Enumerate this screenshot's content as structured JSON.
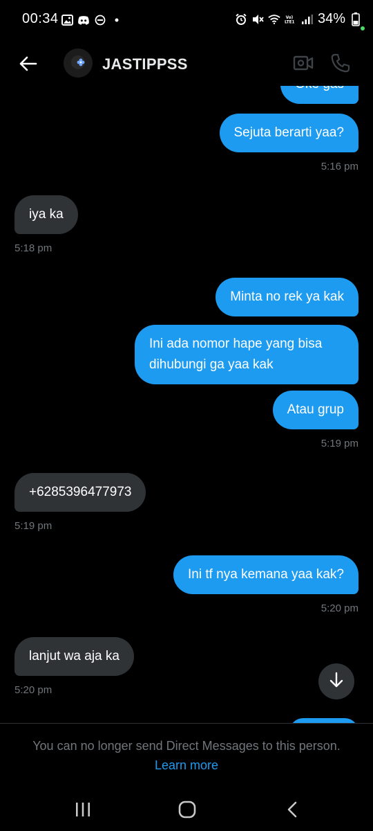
{
  "status_bar": {
    "time": "00:34",
    "battery": "34%",
    "left_icons": [
      "gallery-icon",
      "discord-icon",
      "dnd-icon",
      "dot-icon"
    ],
    "right_icons": [
      "alarm-icon",
      "mute-icon",
      "wifi-icon",
      "volte-icon",
      "signal-icon",
      "battery-icon"
    ]
  },
  "header": {
    "contact_name": "JASTIPPSS",
    "back_icon": "arrow-left-icon",
    "video_icon": "video-call-icon",
    "call_icon": "phone-icon"
  },
  "conversation": {
    "messages": [
      {
        "id": "m0",
        "direction": "out",
        "text": "Oke gas"
      },
      {
        "id": "m1",
        "direction": "out",
        "text": "Sejuta berarti yaa?"
      },
      {
        "id": "m2",
        "direction": "in",
        "text": "iya ka"
      },
      {
        "id": "m3",
        "direction": "out",
        "text": "Minta no rek ya kak"
      },
      {
        "id": "m4",
        "direction": "out",
        "text": "Ini ada nomor hape yang bisa dihubungi ga yaa kak"
      },
      {
        "id": "m5",
        "direction": "out",
        "text": "Atau grup"
      },
      {
        "id": "m6",
        "direction": "in",
        "text": "+6285396477973"
      },
      {
        "id": "m7",
        "direction": "out",
        "text": "Ini tf nya kemana yaa kak?"
      },
      {
        "id": "m8",
        "direction": "in",
        "text": "lanjut wa aja ka"
      }
    ],
    "timestamps": {
      "t1": "5:16 pm",
      "t2": "5:18 pm",
      "t3": "5:19 pm",
      "t4": "5:19 pm",
      "t5": "5:20 pm",
      "t6": "5:20 pm"
    }
  },
  "notice": {
    "text": "You can no longer send Direct Messages to this person.",
    "link": "Learn more"
  },
  "colors": {
    "background": "#000000",
    "outgoing_bubble": "#1d9bf0",
    "incoming_bubble": "#2f3336",
    "timestamp": "#71767b",
    "link": "#1d9bf0"
  },
  "nav_bar": {
    "icons": [
      "recent-apps-icon",
      "home-icon",
      "back-nav-icon"
    ]
  }
}
